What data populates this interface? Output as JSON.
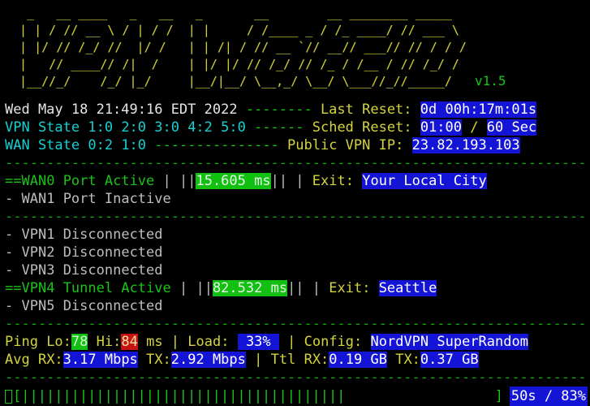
{
  "app": {
    "title": "VPN Watchdog",
    "version_label": "v1.5",
    "ascii_banner": "   _   __ ____   _   __   _       __        __ ________ _____\n  | | / // __ \\ / | / /  | |     / /____ _ / /_ ____/ // ___ \\\n  | |/ // /_/ //  |/ /   | | /| / // __ `// __// ___// // / / /\n  |   // ____// /|  /    | |/ |/ // /_/ // /_ / /__ / // /_/ /\n  |__//_/    /_/ |_/     |__/|__/ \\__,_/ \\__/ \\___//_//_____/"
  },
  "header": {
    "datetime": "Wed May 18 21:49:16 EDT 2022",
    "datetime_sep": " -------- ",
    "last_reset_label": "Last Reset:",
    "last_reset_value": "0d 00h:17m:01s",
    "vpn_state_label": "VPN State",
    "vpn_state_value": "1:0 2:0 3:0 4:2 5:0",
    "vpn_state_sep": " ------ ",
    "sched_reset_label": "Sched Reset:",
    "sched_reset_value": "01:00",
    "sched_reset_divider": "/",
    "sched_reset_interval": "60 Sec",
    "wan_state_label": "WAN State",
    "wan_state_value": "0:2 1:0",
    "wan_state_sep": " --------------- ",
    "public_ip_label": "Public VPN IP:",
    "public_ip_value": "23.82.193.103"
  },
  "separator": "----------------------------------------------------------------------",
  "wan": {
    "ports": [
      {
        "marker": "==",
        "name": "WAN0",
        "status": "Port Active",
        "active": true,
        "meter_left": " | ||",
        "latency": "15.605 ms",
        "meter_right": "|| | ",
        "exit_label": "Exit:",
        "exit_value": "Your Local City"
      },
      {
        "marker": "- ",
        "name": "WAN1",
        "status": "Port Inactive",
        "active": false
      }
    ]
  },
  "vpn": {
    "tunnels": [
      {
        "marker": "- ",
        "name": "VPN1",
        "status": "Disconnected",
        "active": false
      },
      {
        "marker": "- ",
        "name": "VPN2",
        "status": "Disconnected",
        "active": false
      },
      {
        "marker": "- ",
        "name": "VPN3",
        "status": "Disconnected",
        "active": false
      },
      {
        "marker": "==",
        "name": "VPN4",
        "status": "Tunnel Active",
        "active": true,
        "meter_left": " | ||",
        "latency": "82.532 ms",
        "meter_right": "|| | ",
        "exit_label": "Exit:",
        "exit_value": "Seattle"
      },
      {
        "marker": "- ",
        "name": "VPN5",
        "status": "Disconnected",
        "active": false
      }
    ]
  },
  "stats": {
    "ping_label": "Ping ",
    "ping_lo_label": "Lo:",
    "ping_lo_value": "78",
    "ping_hi_label": "Hi:",
    "ping_hi_value": "84",
    "ping_unit": " ms ",
    "pipe": "| ",
    "load_label": "Load: ",
    "load_value": " 33% ",
    "pipe2": " | ",
    "config_label": "Config: ",
    "config_value": "NordVPN SuperRandom",
    "avg_label": "Avg ",
    "avg_rx_label": "RX:",
    "avg_rx_value": "3.17 Mbps",
    "avg_tx_label": "TX:",
    "avg_tx_value": "2.92 Mbps",
    "ttl_label": "Ttl ",
    "ttl_rx_label": "RX:",
    "ttl_rx_value": "0.19 GB",
    "ttl_tx_label": "TX:",
    "ttl_tx_value": "0.37 GB"
  },
  "progress": {
    "open_bracket": "[",
    "ticks": "|||||||||||||||||||||||||||||||||||||||",
    "close_bracket": "]",
    "elapsed": "50s",
    "divider": "/",
    "percent": "83%",
    "stat_text": "50s / 83%"
  },
  "colors": {
    "background": "#000000",
    "banner": "#cdcd3a",
    "version": "#19c319",
    "white": "#e6e6e6",
    "cyan": "#15d0d0",
    "yellow": "#d4d43c",
    "green": "#19c319",
    "grey": "#bdbdbd",
    "highlight_blue": "#1414d6",
    "highlight_green": "#12c012",
    "highlight_red": "#c81212",
    "separator": "#13a313"
  }
}
